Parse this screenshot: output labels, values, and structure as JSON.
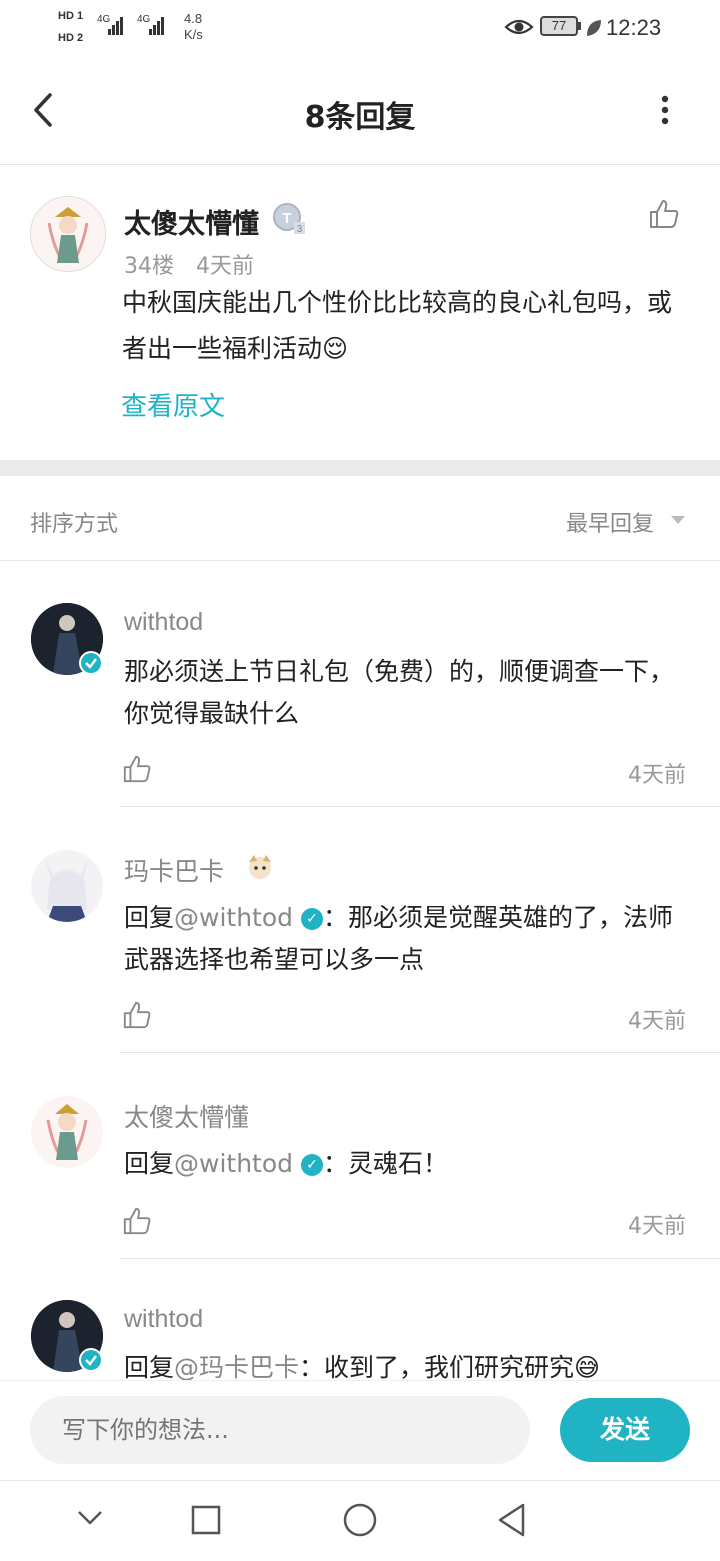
{
  "status_bar": {
    "sim1": "HD 1",
    "sim2": "HD 2",
    "net1": "4G",
    "net2": "4G",
    "speed_value": "4.8",
    "speed_unit": "K/s",
    "battery": "77",
    "time": "12:23"
  },
  "header": {
    "title": "8条回复"
  },
  "post": {
    "author": "太傻太懵懂",
    "floor": "34楼",
    "time": "4天前",
    "content": "中秋国庆能出几个性价比比较高的良心礼包吗，或者出一些福利活动😌",
    "view_original": "查看原文"
  },
  "sort": {
    "label": "排序方式",
    "value": "最早回复"
  },
  "replies": [
    {
      "author": "withtod",
      "text": "那必须送上节日礼包（免费）的，顺便调查一下，你觉得最缺什么",
      "time": "4天前"
    },
    {
      "author": "玛卡巴卡",
      "reply_prefix": "回复",
      "reply_to": "@withtod",
      "text": "：那必须是觉醒英雄的了，法师武器选择也希望可以多一点",
      "time": "4天前"
    },
    {
      "author": "太傻太懵懂",
      "reply_prefix": "回复",
      "reply_to": "@withtod",
      "text": "：灵魂石！",
      "time": "4天前"
    },
    {
      "author": "withtod",
      "reply_prefix": "回复",
      "reply_to": "@玛卡巴卡",
      "text": "：收到了，我们研究研究😅"
    }
  ],
  "composer": {
    "placeholder": "写下你的想法...",
    "send_label": "发送"
  },
  "colors": {
    "accent": "#1fb3c4",
    "divider": "#ebebeb"
  },
  "icons": {
    "back": "chevron-left-icon",
    "more": "more-vertical-icon",
    "like": "thumbs-up-icon",
    "verified": "verified-icon",
    "sort": "triangle-down-icon",
    "nav": [
      "chevron-down-icon",
      "square-icon",
      "circle-icon",
      "triangle-back-icon"
    ]
  }
}
